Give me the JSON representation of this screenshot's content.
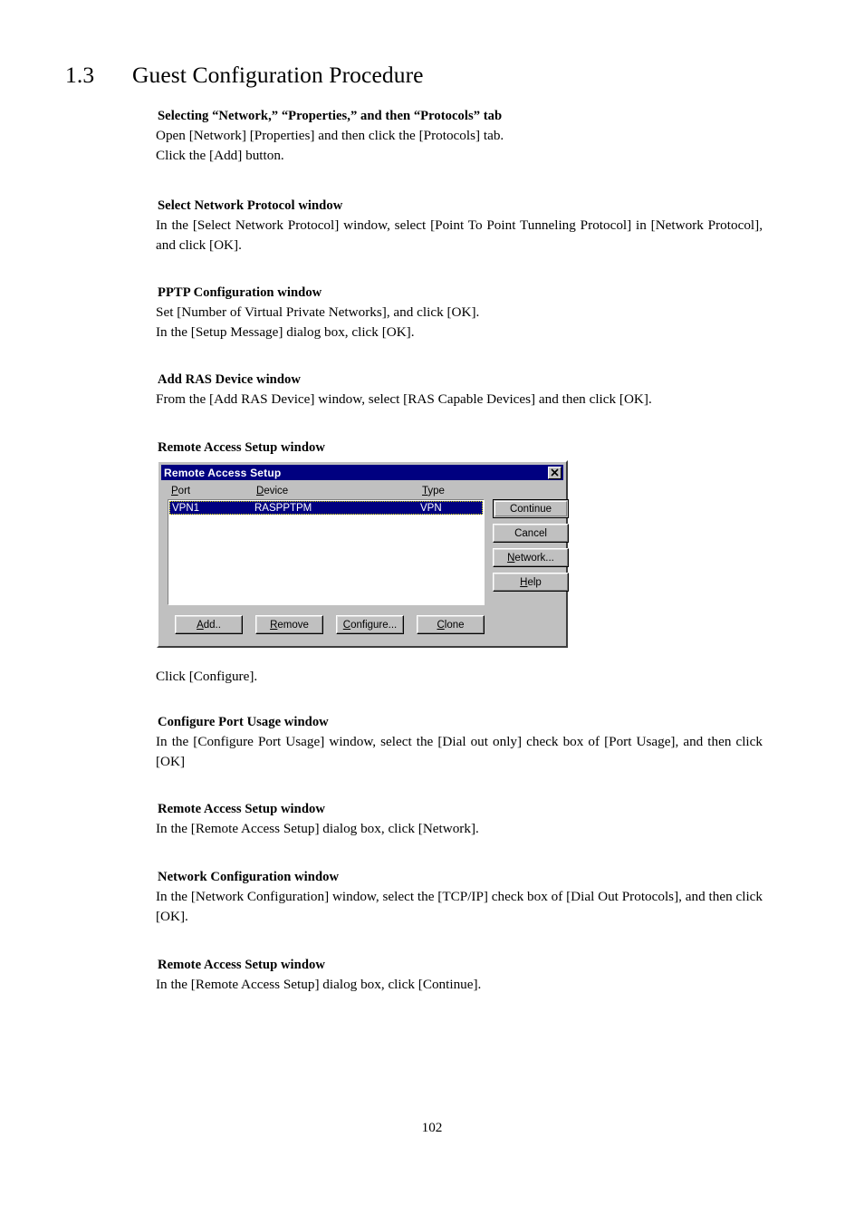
{
  "chapter": {
    "number": "1.3",
    "title": "Guest Configuration Procedure"
  },
  "sections": [
    {
      "heading": "Selecting “Network,” “Properties,” and then “Protocols” tab",
      "line1": "Open [Network] [Properties] and then click the [Protocols] tab.",
      "line2": "Click the [Add] button."
    },
    {
      "heading": "Select Network Protocol window",
      "body": "In the [Select Network Protocol] window, select [Point To Point Tunneling Protocol] in [Network Protocol], and click [OK]."
    },
    {
      "heading": "PPTP Configuration window",
      "line1": "Set [Number of Virtual Private Networks], and click [OK].",
      "line2": "In the [Setup Message] dialog box, click [OK]."
    },
    {
      "heading": "Add RAS Device window",
      "body": "From the [Add RAS Device] window, select [RAS Capable Devices] and then click [OK]."
    },
    {
      "heading": "Remote Access Setup window"
    },
    {
      "heading": "Configure Port Usage window",
      "body": "In the [Configure Port Usage] window, select the [Dial out only] check box of [Port Usage], and then click [OK]"
    },
    {
      "heading": "Remote Access Setup window",
      "body": "In the [Remote Access Setup] dialog box, click [Network]."
    },
    {
      "heading": "Network Configuration window",
      "body": "In the [Network Configuration] window, select the [TCP/IP] check box of [Dial Out Protocols], and then click [OK]."
    },
    {
      "heading": "Remote Access Setup window",
      "body": "In the [Remote Access Setup] dialog box, click [Continue]."
    }
  ],
  "dialog": {
    "title": "Remote Access Setup",
    "close_icon": "close-icon",
    "columns": {
      "port": {
        "mnemonic": "P",
        "rest": "ort"
      },
      "device": {
        "mnemonic": "D",
        "rest": "evice"
      },
      "type": {
        "mnemonic": "T",
        "rest": "ype"
      }
    },
    "rows": [
      {
        "port": "VPN1",
        "device": "RASPPTPM",
        "type": "VPN",
        "selected": true
      }
    ],
    "side_buttons": [
      {
        "mnemonic": "",
        "label": "Continue",
        "default": true
      },
      {
        "mnemonic": "",
        "label": "Cancel",
        "default": false
      },
      {
        "mnemonic": "N",
        "rest": "etwork...",
        "default": false
      },
      {
        "mnemonic": "H",
        "rest": "elp",
        "default": false
      }
    ],
    "bottom_buttons": [
      {
        "mnemonic": "A",
        "rest": "dd.."
      },
      {
        "mnemonic": "R",
        "rest": "emove"
      },
      {
        "mnemonic": "C",
        "rest": "onfigure..."
      },
      {
        "mnemonic": "C",
        "rest": "lone"
      }
    ]
  },
  "after_dialog_text": "Click [Configure].",
  "page_number": "102"
}
